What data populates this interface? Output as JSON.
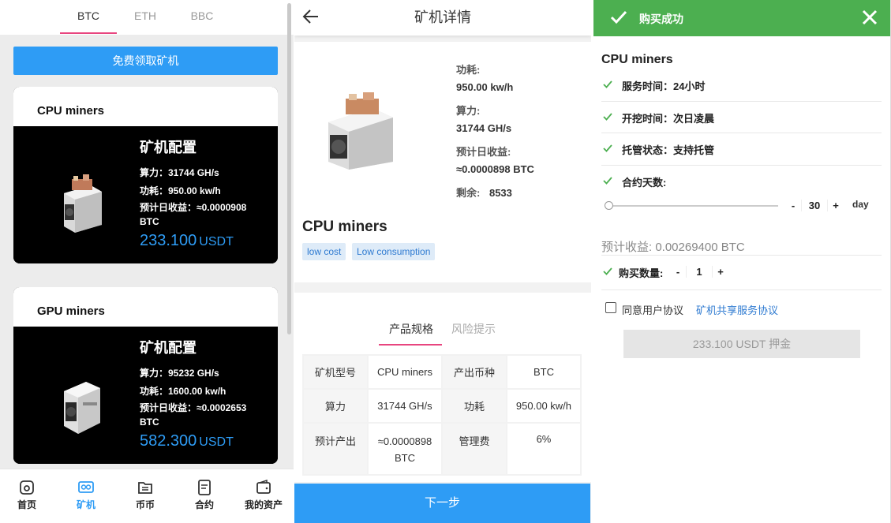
{
  "list": {
    "tabs": [
      "BTC",
      "ETH",
      "BBC"
    ],
    "free_button": "免费领取矿机",
    "cards": [
      {
        "name": "CPU miners",
        "config_title": "矿机配置",
        "hashrate": "算力：31744 GH/s",
        "power": "功耗：950.00 kw/h",
        "income_line1": "预计日收益：≈0.0000908",
        "income_line2": "BTC",
        "price": "233.100",
        "currency": "USDT"
      },
      {
        "name": "GPU miners",
        "config_title": "矿机配置",
        "hashrate": "算力：95232 GH/s",
        "power": "功耗：1600.00 kw/h",
        "income_line1": "预计日收益：≈0.0002653",
        "income_line2": "BTC",
        "price": "582.300",
        "currency": "USDT"
      }
    ],
    "nav": [
      "首页",
      "矿机",
      "币币",
      "合约",
      "我的资产"
    ]
  },
  "detail": {
    "title": "矿机详情",
    "power_label": "功耗:",
    "power_value": "950.00 kw/h",
    "hashrate_label": "算力:",
    "hashrate_value": "31744 GH/s",
    "income_label": "预计日收益:",
    "income_value": "≈0.0000898 BTC",
    "remaining_label": "剩余:",
    "remaining_value": "8533",
    "name": "CPU miners",
    "tags": [
      "low cost",
      "Low consumption"
    ],
    "tabs": [
      "产品规格",
      "风险提示"
    ],
    "table": {
      "r1": [
        "矿机型号",
        "CPU miners",
        "产出币种",
        "BTC"
      ],
      "r2": [
        "算力",
        "31744 GH/s",
        "功耗",
        "950.00 kw/h"
      ],
      "r3": [
        "预计产出",
        "≈0.0000898",
        "BTC",
        "管理费",
        "6%"
      ]
    },
    "next_button": "下一步"
  },
  "purchase": {
    "success_message": "购买成功",
    "name": "CPU miners",
    "service_time": "服务时间：24小时",
    "mining_time": "开挖时间：次日凌晨",
    "hosting_status": "托管状态：支持托管",
    "contract_days_label": "合约天数:",
    "contract_days": "30",
    "contract_days_position": 0,
    "day_unit": "day",
    "estimated_income": "预计收益: 0.00269400 BTC",
    "quantity_label": "购买数量:",
    "quantity": "1",
    "minus": "-",
    "plus": "+",
    "agree_text": "同意用户协议",
    "agreement_link": "矿机共享服务协议",
    "pay_button": "233.100 USDT 押金"
  },
  "colors": {
    "primary": "#2e9cf5",
    "accent_pink": "#e8457f",
    "success_green": "#4caf50",
    "check_green": "#4caf50"
  }
}
